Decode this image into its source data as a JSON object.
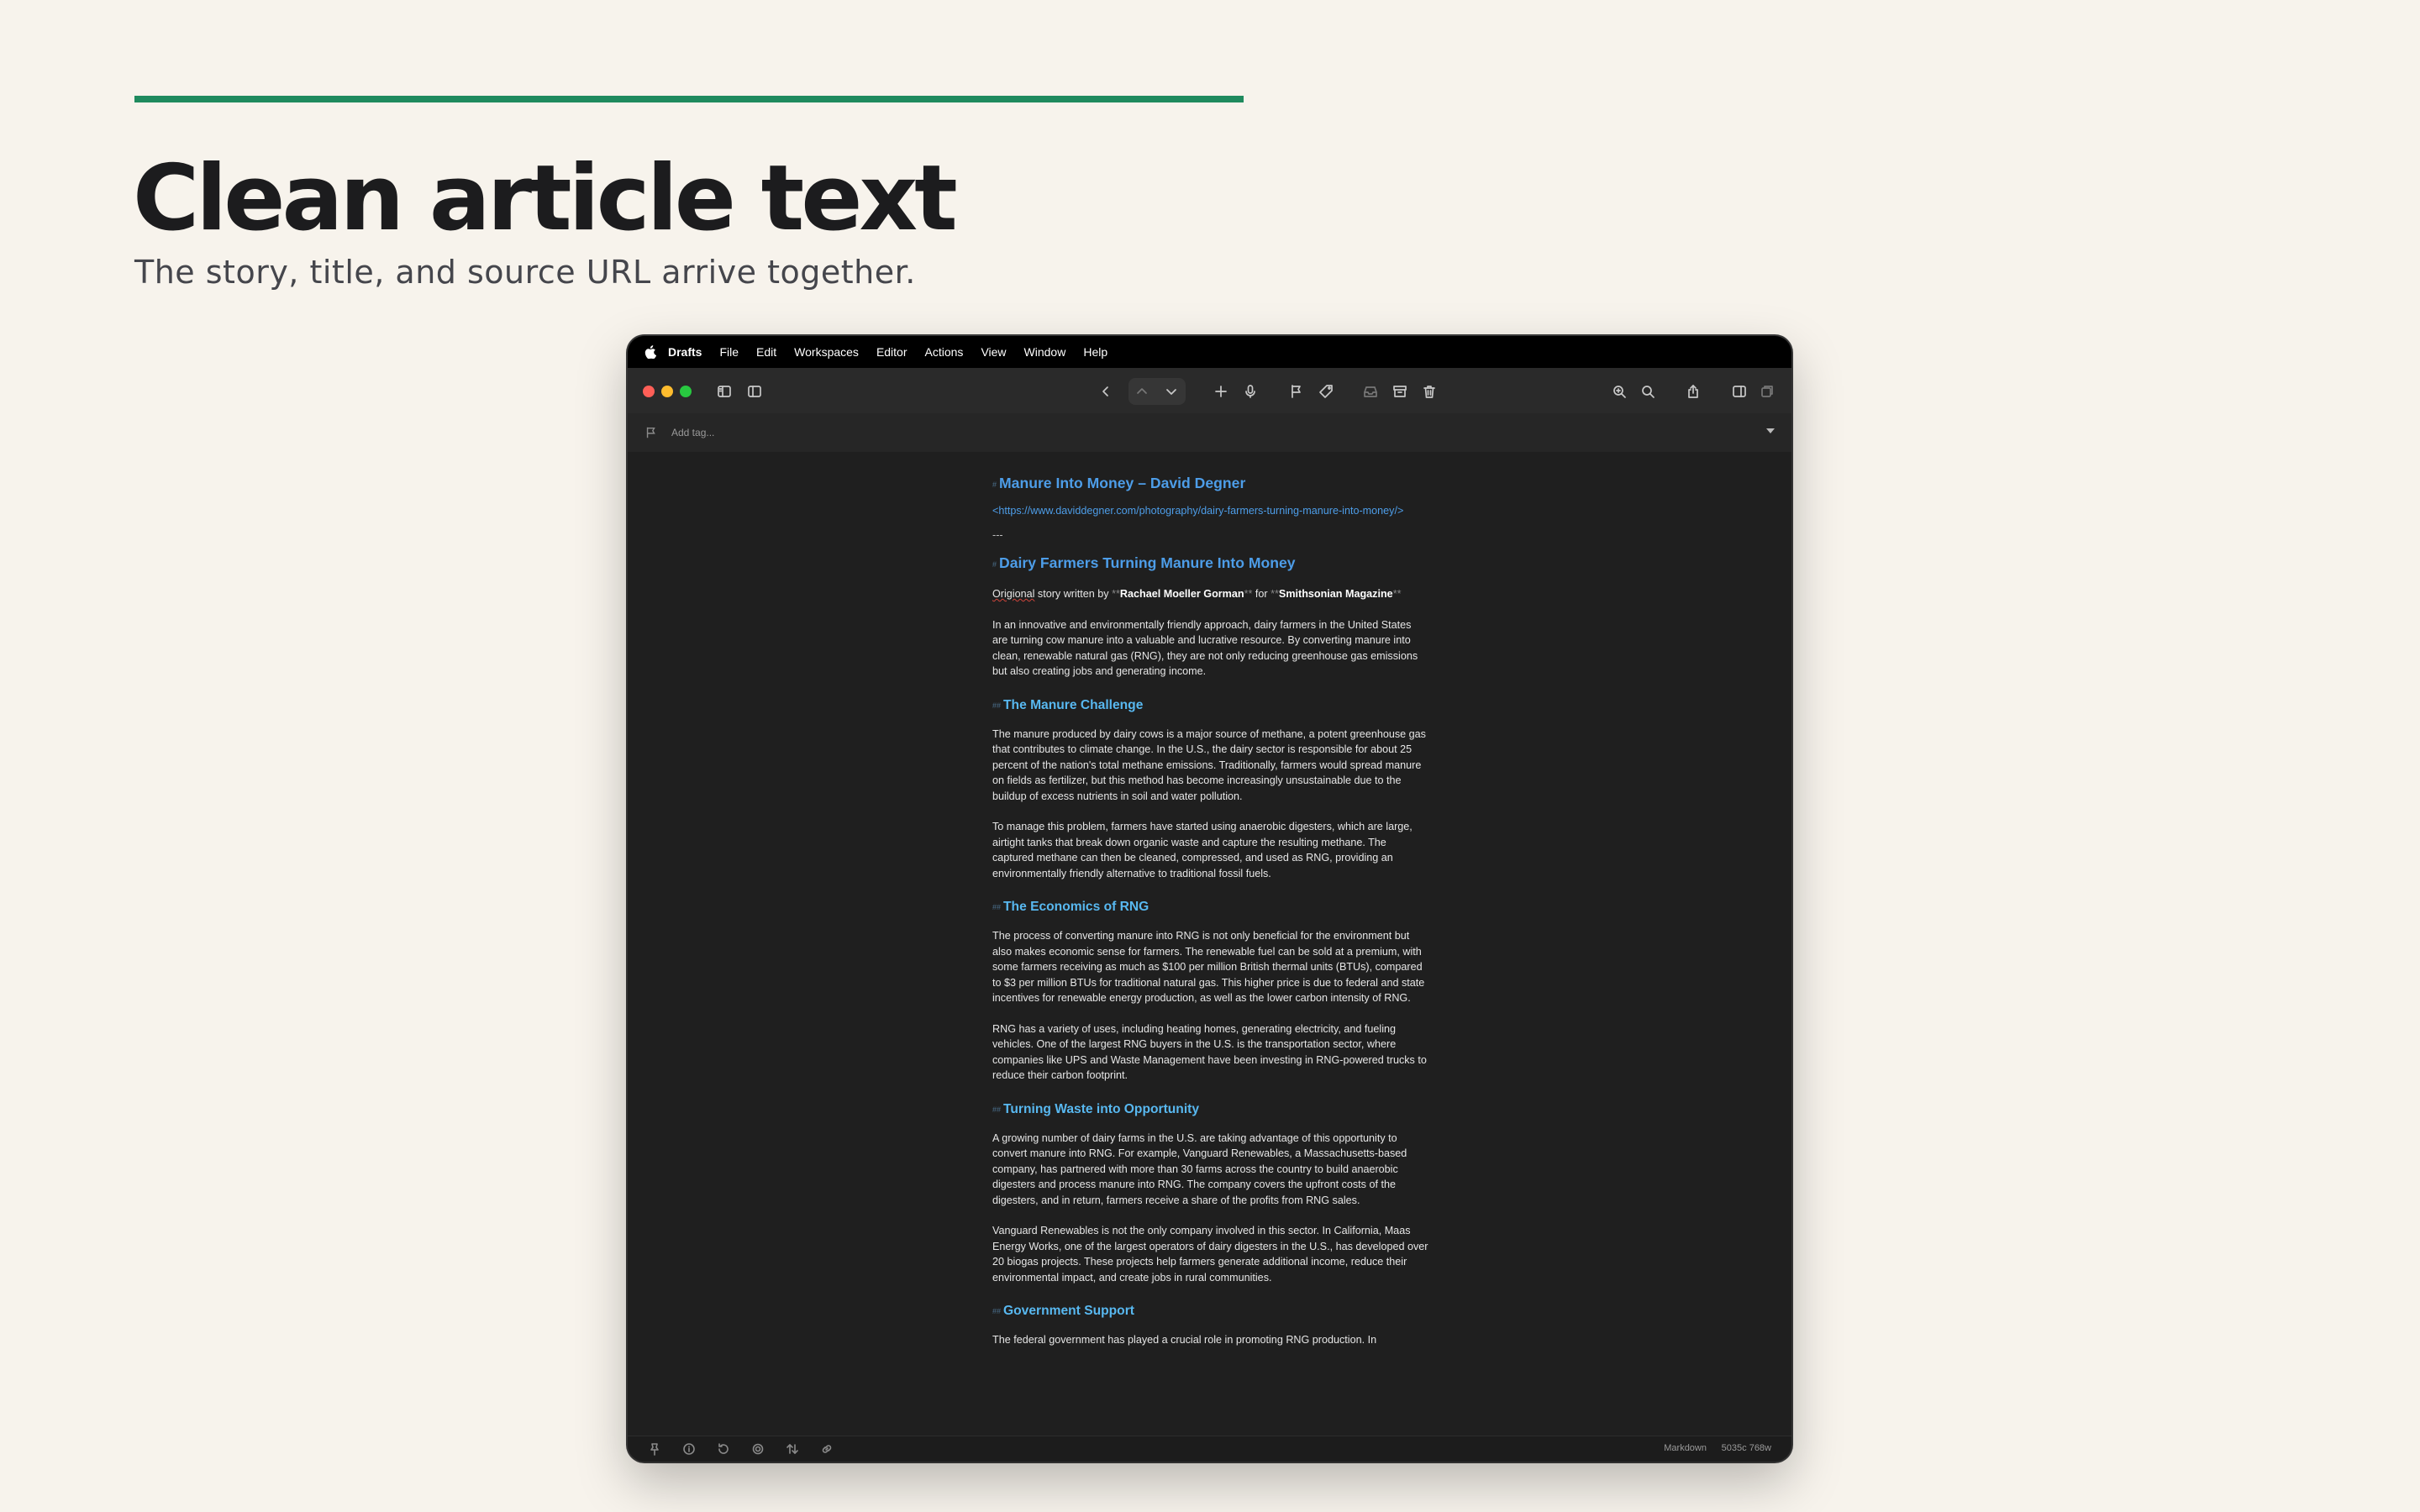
{
  "hero": {
    "title": "Clean article text",
    "subtitle": "The story, title, and source URL arrive together."
  },
  "colors": {
    "accent": "#1f8a5e",
    "heading": "#4d9de8",
    "subheading": "#58b8f0",
    "editor_bg": "#1f1f1f"
  },
  "menubar": {
    "app": "Drafts",
    "items": [
      "File",
      "Edit",
      "Workspaces",
      "Editor",
      "Actions",
      "View",
      "Window",
      "Help"
    ]
  },
  "toolbar": {
    "icons": [
      "sidebar-left-icon",
      "sidebar-icon",
      "chevron-left-icon",
      "chevron-up-icon",
      "chevron-down-icon",
      "plus-icon",
      "microphone-icon",
      "flag-icon",
      "tag-icon",
      "inbox-icon",
      "archive-icon",
      "trash-icon",
      "zoom-in-icon",
      "search-icon",
      "share-icon",
      "split-view-icon",
      "window-icon"
    ]
  },
  "tagbar": {
    "placeholder": "Add tag..."
  },
  "document": {
    "title_mark": "#",
    "title": "Manure Into Money – David Degner",
    "url": "<https://www.daviddegner.com/photography/dairy-farmers-turning-manure-into-money/>",
    "rule": "---",
    "h1": "Dairy Farmers Turning Manure Into Money",
    "byline": {
      "misspelled": "Origional",
      "text1": " story written by ",
      "md_open": "**",
      "author": "Rachael Moeller Gorman",
      "md_close": "**",
      "text2": " for ",
      "publication": "Smithsonian Magazine"
    },
    "intro": "In an innovative and environmentally friendly approach, dairy farmers in the United States are turning cow manure into a valuable and lucrative resource. By converting manure into clean, renewable natural gas (RNG), they are not only reducing greenhouse gas emissions but also creating jobs and generating income.",
    "h2_mark": "##",
    "sections": [
      {
        "heading": "The Manure Challenge",
        "paragraphs": [
          "The manure produced by dairy cows is a major source of methane, a potent greenhouse gas that contributes to climate change. In the U.S., the dairy sector is responsible for about 25 percent of the nation's total methane emissions. Traditionally, farmers would spread manure on fields as fertilizer, but this method has become increasingly unsustainable due to the buildup of excess nutrients in soil and water pollution.",
          "To manage this problem, farmers have started using anaerobic digesters, which are large, airtight tanks that break down organic waste and capture the resulting methane. The captured methane can then be cleaned, compressed, and used as RNG, providing an environmentally friendly alternative to traditional fossil fuels."
        ]
      },
      {
        "heading": "The Economics of RNG",
        "paragraphs": [
          "The process of converting manure into RNG is not only beneficial for the environment but also makes economic sense for farmers. The renewable fuel can be sold at a premium, with some farmers receiving as much as $100 per million British thermal units (BTUs), compared to $3 per million BTUs for traditional natural gas. This higher price is due to federal and state incentives for renewable energy production, as well as the lower carbon intensity of RNG.",
          "RNG has a variety of uses, including heating homes, generating electricity, and fueling vehicles. One of the largest RNG buyers in the U.S. is the transportation sector, where companies like UPS and Waste Management have been investing in RNG-powered trucks to reduce their carbon footprint."
        ]
      },
      {
        "heading": "Turning Waste into Opportunity",
        "paragraphs": [
          "A growing number of dairy farms in the U.S. are taking advantage of this opportunity to convert manure into RNG. For example, Vanguard Renewables, a Massachusetts-based company, has partnered with more than 30 farms across the country to build anaerobic digesters and process manure into RNG. The company covers the upfront costs of the digesters, and in return, farmers receive a share of the profits from RNG sales.",
          "Vanguard Renewables is not the only company involved in this sector. In California, Maas Energy Works, one of the largest operators of dairy digesters in the U.S., has developed over 20 biogas projects. These projects help farmers generate additional income, reduce their environmental impact, and create jobs in rural communities."
        ]
      },
      {
        "heading": "Government Support",
        "paragraphs": [
          "The federal government has played a crucial role in promoting RNG production. In"
        ]
      }
    ]
  },
  "statusbar": {
    "icons": [
      "pin-icon",
      "info-icon",
      "history-icon",
      "gear-icon",
      "sort-icon",
      "link-icon"
    ],
    "syntax": "Markdown",
    "counts": "5035c 768w"
  }
}
